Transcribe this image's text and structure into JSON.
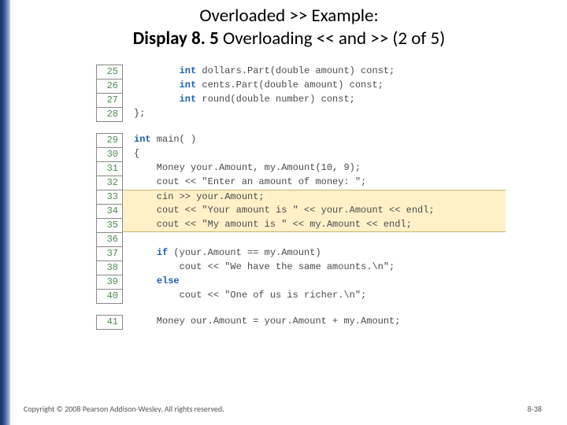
{
  "title": {
    "line1": "Overloaded >> Example:",
    "line2_bold": "Display 8. 5",
    "line2_rest": "  Overloading << and >> (2 of 5)"
  },
  "code": {
    "l25": {
      "n": "25",
      "kw": "int",
      "rest": " dollars.Part(double amount) const;"
    },
    "l26": {
      "n": "26",
      "kw": "int",
      "rest": " cents.Part(double amount) const;"
    },
    "l27": {
      "n": "27",
      "kw": "int",
      "rest": " round(double number) const;"
    },
    "l28": {
      "n": "28",
      "txt": "};"
    },
    "l29": {
      "n": "29",
      "kw": "int",
      "rest": " main( )"
    },
    "l30": {
      "n": "30",
      "txt": "{"
    },
    "l31": {
      "n": "31",
      "txt": "    Money your.Amount, my.Amount(10, 9);"
    },
    "l32": {
      "n": "32",
      "txt": "    cout << \"Enter an amount of money: \";"
    },
    "l33": {
      "n": "33",
      "txt": "    cin >> your.Amount;"
    },
    "l34": {
      "n": "34",
      "txt": "    cout << \"Your amount is \" << your.Amount << endl;"
    },
    "l35": {
      "n": "35",
      "txt": "    cout << \"My amount is \" << my.Amount << endl;"
    },
    "l36": {
      "n": "36",
      "txt": ""
    },
    "l37": {
      "n": "37",
      "kw": "if",
      "rest": " (your.Amount == my.Amount)"
    },
    "l38": {
      "n": "38",
      "txt": "        cout << \"We have the same amounts.\\n\";"
    },
    "l39": {
      "n": "39",
      "kw": "else",
      "rest": ""
    },
    "l40": {
      "n": "40",
      "txt": "        cout << \"One of us is richer.\\n\";"
    },
    "l41": {
      "n": "41",
      "txt": "    Money our.Amount = your.Amount + my.Amount;"
    }
  },
  "footer": {
    "copyright": "Copyright © 2008 Pearson Addison-Wesley. All rights reserved.",
    "page": "8-38"
  }
}
